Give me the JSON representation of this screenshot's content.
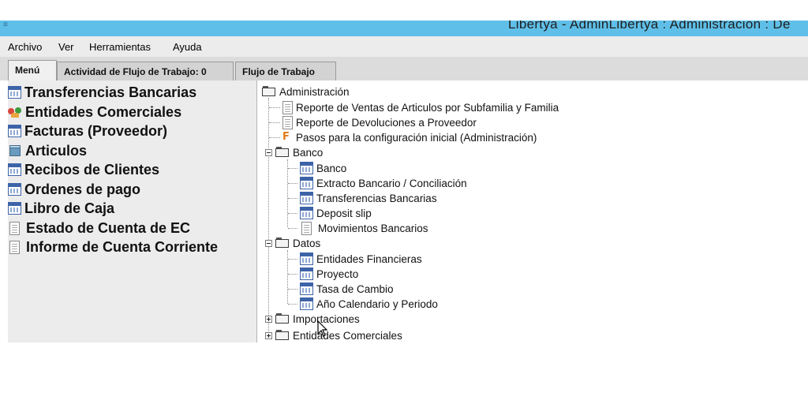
{
  "window": {
    "title": "Libertya   -   AdminLibertya : Administración : De"
  },
  "menubar": {
    "items": [
      "Archivo",
      "Ver",
      "Herramientas",
      "Ayuda"
    ]
  },
  "tabs": [
    "Menú",
    "Actividad de Flujo de Trabajo: 0",
    "Flujo de Trabajo"
  ],
  "favorites": [
    {
      "label": "Transferencias Bancarias",
      "icon": "window-icon"
    },
    {
      "label": "Entidades Comerciales",
      "icon": "people-icon"
    },
    {
      "label": "Facturas (Proveedor)",
      "icon": "window-icon"
    },
    {
      "label": "Articulos",
      "icon": "product-icon"
    },
    {
      "label": "Recibos de Clientes",
      "icon": "window-icon"
    },
    {
      "label": "Ordenes de pago",
      "icon": "window-icon"
    },
    {
      "label": "Libro de Caja",
      "icon": "window-icon"
    },
    {
      "label": "Estado de Cuenta de EC",
      "icon": "report-icon"
    },
    {
      "label": "Informe de Cuenta Corriente",
      "icon": "report-icon"
    }
  ],
  "tree": {
    "root": "Administración",
    "items": [
      {
        "label": "Reporte de Ventas de Articulos por Subfamilia y Familia",
        "icon": "report-icon"
      },
      {
        "label": "Reporte de Devoluciones a Proveedor",
        "icon": "report-icon"
      },
      {
        "label": "Pasos para la configuración inicial (Administración)",
        "icon": "workflow-icon"
      },
      {
        "label": "Banco",
        "icon": "folder-icon"
      },
      {
        "label": "Banco",
        "icon": "window-icon"
      },
      {
        "label": "Extracto Bancario / Conciliación",
        "icon": "window-icon"
      },
      {
        "label": "Transferencias Bancarias",
        "icon": "window-icon"
      },
      {
        "label": "Deposit slip",
        "icon": "window-icon"
      },
      {
        "label": "Movimientos Bancarios",
        "icon": "report-icon"
      },
      {
        "label": "Datos",
        "icon": "folder-icon"
      },
      {
        "label": "Entidades Financieras",
        "icon": "window-icon"
      },
      {
        "label": "Proyecto",
        "icon": "window-icon"
      },
      {
        "label": "Tasa de Cambio",
        "icon": "window-icon"
      },
      {
        "label": "Año Calendario y Periodo",
        "icon": "window-icon"
      },
      {
        "label": "Importaciones",
        "icon": "folder-icon"
      },
      {
        "label": "Entidades Comerciales",
        "icon": "folder-icon"
      }
    ]
  }
}
